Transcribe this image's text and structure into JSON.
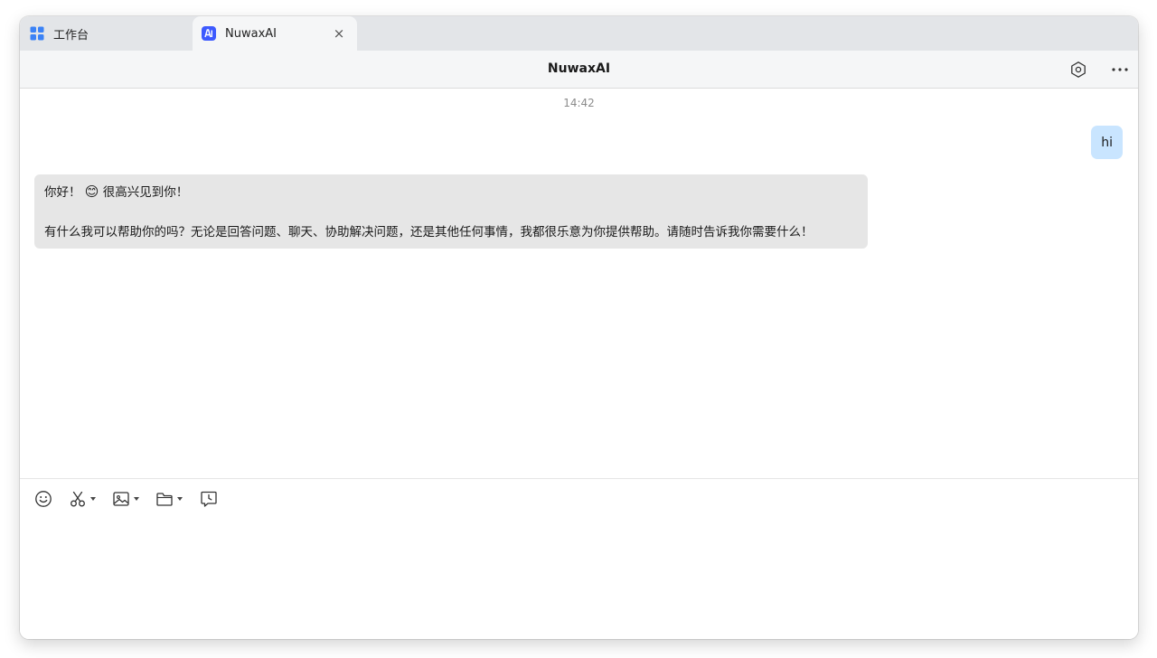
{
  "tabs": [
    {
      "label": "工作台",
      "icon": "apps-grid-icon",
      "active": false
    },
    {
      "label": "NuwaxAI",
      "icon": "nuwax-logo-icon",
      "active": true
    }
  ],
  "tab_close_glyph": "×",
  "header": {
    "title": "NuwaxAI",
    "settings_icon": "settings-hexagon-icon",
    "more_icon": "more-dots-icon"
  },
  "conversation": {
    "timestamp": "14:42",
    "user_message": "hi",
    "bot_message": {
      "line1_pre": "你好！",
      "emoji": "😊",
      "line1_post": "很高兴见到你！",
      "line2": "有什么我可以帮助你的吗？无论是回答问题、聊天、协助解决问题，还是其他任何事情，我都很乐意为你提供帮助。请随时告诉我你需要什么！"
    }
  },
  "toolbar_icons": [
    "emoji-icon",
    "scissors-icon",
    "image-icon",
    "folder-icon",
    "chat-history-icon"
  ],
  "colors": {
    "user_bubble": "#c9e5ff",
    "bot_bubble": "#e6e6e6",
    "accent": "#3d5afe",
    "tab_bar": "#e3e5e8"
  }
}
